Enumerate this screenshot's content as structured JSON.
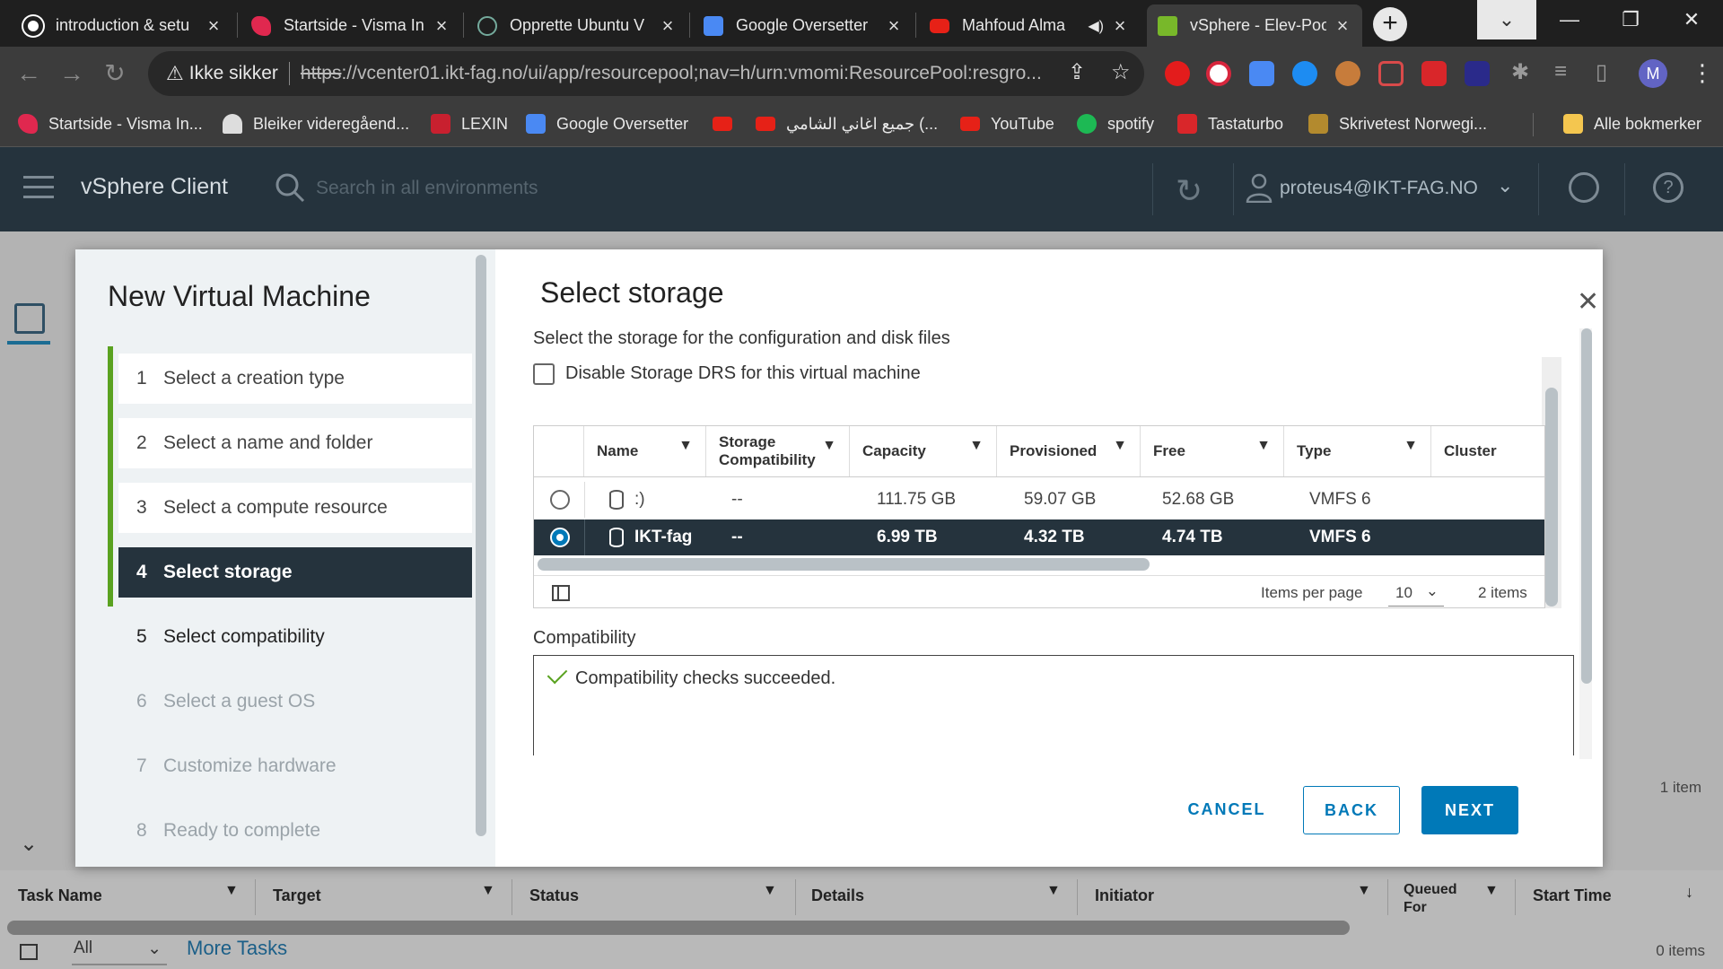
{
  "browser": {
    "tabs": [
      {
        "title": "introduction & setu",
        "color": "#1f1f1f"
      },
      {
        "title": "Startside - Visma In",
        "color": "#e0284f"
      },
      {
        "title": "Opprette Ubuntu V",
        "color": "#74aa9c"
      },
      {
        "title": "Google Oversetter",
        "color": "#4a89f3"
      },
      {
        "title": "Mahfoud Alma",
        "color": "#e62117"
      },
      {
        "title": "vSphere - Elev-Pool",
        "color": "#78b82a"
      }
    ],
    "new_tab": "+",
    "security_label": "Ikke sikker",
    "url_scheme": "https",
    "url_rest": "://vcenter01.ikt-fag.no/ui/app/resourcepool;nav=h/urn:vmomi:ResourcePool:resgro...",
    "profile_initial": "M",
    "bookmarks": [
      "Startside - Visma In...",
      "Bleiker videregåend...",
      "LEXIN",
      "Google Oversetter",
      "",
      "جميع اغاني الشامي (...",
      "YouTube",
      "spotify",
      "Tastaturbo",
      "Skrivetest Norwegi..."
    ],
    "all_bookmarks": "Alle bokmerker"
  },
  "vsphere": {
    "app_title": "vSphere Client",
    "search_placeholder": "Search in all environments",
    "user": "proteus4@IKT-FAG.NO"
  },
  "wizard": {
    "title": "New Virtual Machine",
    "steps": [
      {
        "num": "1",
        "label": "Select a creation type"
      },
      {
        "num": "2",
        "label": "Select a name and folder"
      },
      {
        "num": "3",
        "label": "Select a compute resource"
      },
      {
        "num": "4",
        "label": "Select storage"
      },
      {
        "num": "5",
        "label": "Select compatibility"
      },
      {
        "num": "6",
        "label": "Select a guest OS"
      },
      {
        "num": "7",
        "label": "Customize hardware"
      },
      {
        "num": "8",
        "label": "Ready to complete"
      }
    ],
    "page_title": "Select storage",
    "description": "Select the storage for the configuration and disk files",
    "disable_drs_label": "Disable Storage DRS for this virtual machine",
    "grid": {
      "columns": [
        "Name",
        "Storage Compatibility",
        "Capacity",
        "Provisioned",
        "Free",
        "Type",
        "Cluster"
      ],
      "rows": [
        {
          "name": ":)",
          "compat": "--",
          "capacity": "111.75 GB",
          "provisioned": "59.07 GB",
          "free": "52.68 GB",
          "type": "VMFS 6",
          "cluster": "",
          "selected": false
        },
        {
          "name": "IKT-fag",
          "compat": "--",
          "capacity": "6.99 TB",
          "provisioned": "4.32 TB",
          "free": "4.74 TB",
          "type": "VMFS 6",
          "cluster": "",
          "selected": true
        }
      ],
      "items_per_page_label": "Items per page",
      "items_per_page": "10",
      "item_count": "2 items"
    },
    "compatibility_label": "Compatibility",
    "compatibility_message": "Compatibility checks succeeded.",
    "buttons": {
      "cancel": "CANCEL",
      "back": "BACK",
      "next": "NEXT"
    }
  },
  "background": {
    "right_count": "1 item",
    "tasks": {
      "columns": [
        "Task Name",
        "Target",
        "Status",
        "Details",
        "Initiator",
        "Queued For",
        "Start Time"
      ],
      "filter_value": "All",
      "more_tasks": "More Tasks",
      "count": "0 items"
    }
  },
  "colors": {
    "header_bg": "#25333d",
    "accent": "#0079b8",
    "success": "#5aa220"
  }
}
